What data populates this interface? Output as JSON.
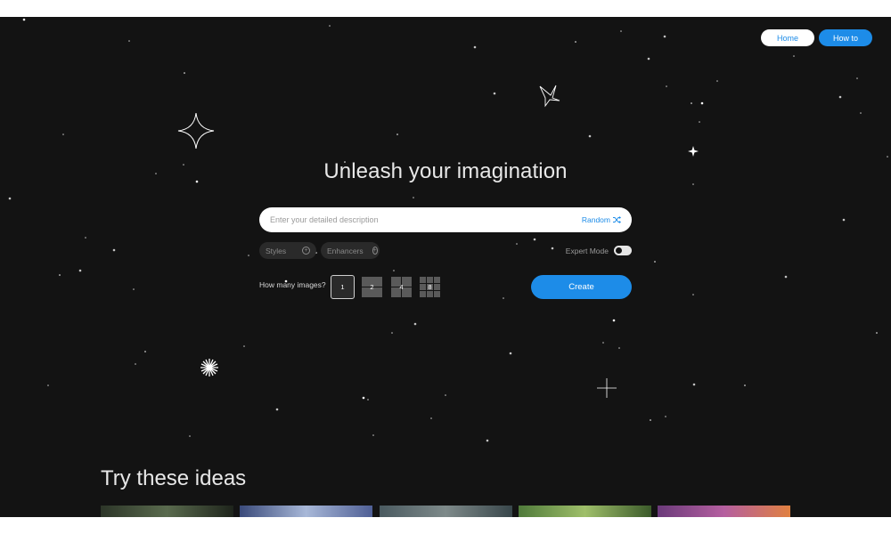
{
  "nav": {
    "home_label": "Home",
    "howto_label": "How to"
  },
  "hero": {
    "title": "Unleash your imagination"
  },
  "prompt": {
    "placeholder": "Enter your detailed description",
    "random_label": "Random"
  },
  "chips": {
    "styles_label": "Styles",
    "enhancers_label": "Enhancers"
  },
  "expert": {
    "label": "Expert Mode",
    "enabled": true
  },
  "image_count": {
    "label": "How many images?",
    "options": [
      "1",
      "2",
      "4",
      "8"
    ],
    "selected": "1"
  },
  "create_label": "Create",
  "ideas": {
    "title": "Try these ideas",
    "thumbnails": [
      {
        "name": "idea-thumbnail-forest-light",
        "colors": [
          "#2c3528",
          "#5a6b4e",
          "#1e241b"
        ]
      },
      {
        "name": "idea-thumbnail-blue-clouds",
        "colors": [
          "#3a4a7a",
          "#a8b8d8",
          "#4f5f95"
        ]
      },
      {
        "name": "idea-thumbnail-misty-rock",
        "colors": [
          "#4a5a60",
          "#7e8a8a",
          "#38464a"
        ]
      },
      {
        "name": "idea-thumbnail-green-jungle",
        "colors": [
          "#4f7a3a",
          "#9fbf6a",
          "#3b5a2a"
        ]
      },
      {
        "name": "idea-thumbnail-purple-flowers",
        "colors": [
          "#6a3a7a",
          "#b55fa0",
          "#e08040"
        ]
      }
    ]
  },
  "colors": {
    "accent": "#1d8ce8",
    "background": "#131313",
    "text": "#e8e8e8"
  }
}
